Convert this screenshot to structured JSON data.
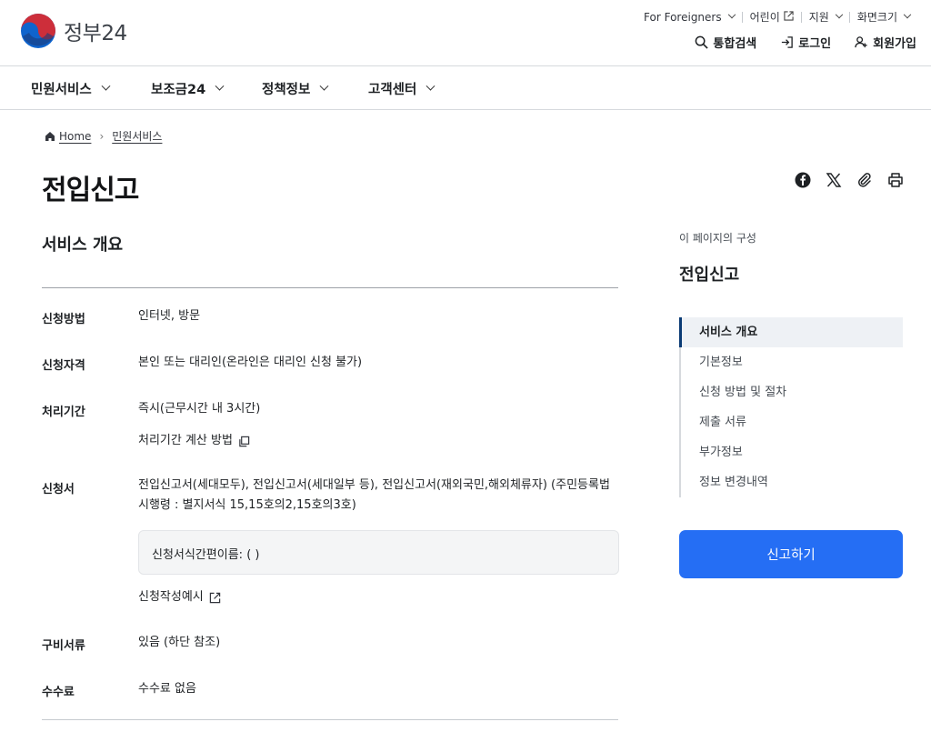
{
  "brand": {
    "logo_text": "정부24"
  },
  "util_nav": {
    "foreigners": "For Foreigners",
    "kids": "어린이",
    "support": "지원",
    "screen_size": "화면크기"
  },
  "actions": {
    "search": "통합검색",
    "login": "로그인",
    "signup": "회원가입"
  },
  "gnb": [
    "민원서비스",
    "보조금24",
    "정책정보",
    "고객센터"
  ],
  "breadcrumb": {
    "home": "Home",
    "current": "민원서비스"
  },
  "page_title": "전입신고",
  "share_icons": [
    "facebook-icon",
    "x-icon",
    "link-icon",
    "print-icon"
  ],
  "section": {
    "title": "서비스 개요",
    "rows": {
      "method": {
        "label": "신청방법",
        "value": "인터넷, 방문"
      },
      "eligibility": {
        "label": "신청자격",
        "value": "본인 또는 대리인(온라인은 대리인 신청 불가)"
      },
      "period": {
        "label": "처리기간",
        "value": "즉시(근무시간 내 3시간)",
        "link": "처리기간 계산 방법"
      },
      "form": {
        "label": "신청서",
        "value": "전입신고서(세대모두), 전입신고서(세대일부 등), 전입신고서(재외국민,해외체류자) (주민등록법 시행령 : 별지서식 15,15호의2,15호의3호)",
        "box": "신청서식간편이름: ( )",
        "example_link": "신청작성예시"
      },
      "documents": {
        "label": "구비서류",
        "value": "있음 (하단 참조)"
      },
      "fee": {
        "label": "수수료",
        "value": "수수료 없음"
      }
    }
  },
  "sidebar": {
    "caption": "이 페이지의 구성",
    "title": "전입신고",
    "toc": [
      "서비스 개요",
      "기본정보",
      "신청 방법 및 절차",
      "제출 서류",
      "부가정보",
      "정보 변경내역"
    ],
    "cta": "신고하기"
  },
  "colors": {
    "primary": "#256ef4",
    "toc_active_bar": "#0b3b75",
    "logo_red": "#cd2e3a",
    "logo_blue": "#0f64cd"
  }
}
